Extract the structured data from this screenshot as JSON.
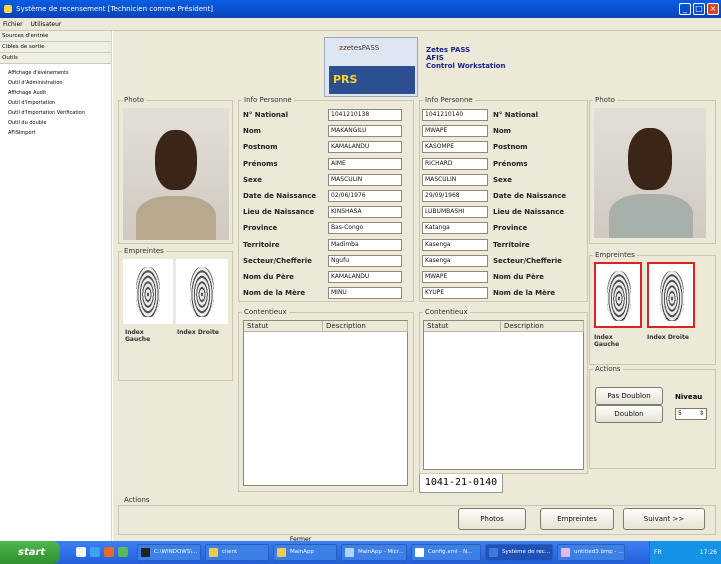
{
  "window": {
    "title": "Système de recensement [Technicien comme Président]"
  },
  "menu": [
    "Fichier",
    "Utilisateur"
  ],
  "nav": {
    "headers": [
      "Sources d'entrée",
      "Cibles de sortie",
      "Outils"
    ],
    "items": [
      "Affichage d'événements",
      "Outil d'Administration",
      "Affichage Audit",
      "Outil d'Importation",
      "Outil d'Importation Vérification",
      "Outil du double",
      "AFISImport"
    ]
  },
  "brand": {
    "logo_text": "zetesPASS",
    "prs": "PRS",
    "line1": "Zetes PASS",
    "line2": "AFIS",
    "line3": "Control Workstation"
  },
  "left": {
    "photo_label": "Photo",
    "info_label": "Info Personne",
    "empreintes_label": "Empreintes",
    "fp_left": "Index Gauche",
    "fp_right": "Index Droite",
    "fields": [
      {
        "label": "N° National",
        "value": "1041210138"
      },
      {
        "label": "Nom",
        "value": "MAKANGILU"
      },
      {
        "label": "Postnom",
        "value": "KAMALANDU"
      },
      {
        "label": "Prénoms",
        "value": "AIME"
      },
      {
        "label": "Sexe",
        "value": "MASCULIN"
      },
      {
        "label": "Date de Naissance",
        "value": "02/06/1976"
      },
      {
        "label": "Lieu de Naissance",
        "value": "KINSHASA"
      },
      {
        "label": "Province",
        "value": "Bas-Congo"
      },
      {
        "label": "Territoire",
        "value": "Madimba"
      },
      {
        "label": "Secteur/Chefferie",
        "value": "Ngufu"
      },
      {
        "label": "Nom du Père",
        "value": "KAMALANDU"
      },
      {
        "label": "Nom de la Mère",
        "value": "MINU"
      }
    ],
    "contentieux_label": "Contentieux",
    "col_statut": "Statut",
    "col_desc": "Description"
  },
  "right": {
    "photo_label": "Photo",
    "info_label": "Info Personne",
    "empreintes_label": "Empreintes",
    "fp_left": "Index Gauche",
    "fp_right": "Index Droite",
    "fields": [
      {
        "label": "N° National",
        "value": "1041210140"
      },
      {
        "label": "Nom",
        "value": "MWAPE"
      },
      {
        "label": "Postnom",
        "value": "KASOMPE"
      },
      {
        "label": "Prénoms",
        "value": "RICHARD"
      },
      {
        "label": "Sexe",
        "value": "MASCULIN"
      },
      {
        "label": "Date de Naissance",
        "value": "29/09/1968"
      },
      {
        "label": "Lieu de Naissance",
        "value": "LUBUMBASHI"
      },
      {
        "label": "Province",
        "value": "Katanga"
      },
      {
        "label": "Territoire",
        "value": "Kasenga"
      },
      {
        "label": "Secteur/Chefferie",
        "value": "Kasenga"
      },
      {
        "label": "Nom du Père",
        "value": "MWAPE"
      },
      {
        "label": "Nom de la Mère",
        "value": "KYUPE"
      }
    ],
    "contentieux_label": "Contentieux",
    "col_statut": "Statut",
    "col_desc": "Description",
    "tab": "1041-21-0140"
  },
  "actions_panel": {
    "label": "Actions",
    "pas_doublon": "Pas Doublon",
    "doublon": "Doublon",
    "niveau_label": "Niveau",
    "niveau_value": "5"
  },
  "bottom_actions": {
    "label": "Actions",
    "photos": "Photos",
    "empreintes": "Empreintes",
    "suivant": "Suivant >>"
  },
  "fermer": "Fermer",
  "taskbar": {
    "start": "start",
    "tasks": [
      "C:\\WINDOWS\\...",
      "client",
      "MainApp",
      "MainApp - Micr...",
      "Config.xml - N...",
      "Système de rec...",
      "untitled3.bmp - ..."
    ],
    "clock": "17:26",
    "lang": "FR"
  }
}
